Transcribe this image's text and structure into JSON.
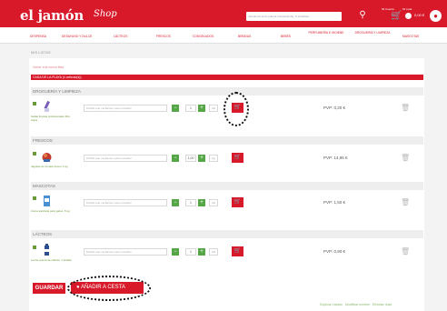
{
  "header": {
    "brand": "el jamón",
    "brand_script": "Shop",
    "search_placeholder": "Introduzca texto para la búsqueda (Ej.: 5 estrellas)",
    "utility_1": "Mi Cuenta",
    "utility_2": "Mi Lista",
    "cart_total": "0,00 €"
  },
  "nav": {
    "items": [
      "DESPENSA",
      "DESAYUNO Y DULCE",
      "LÁCTEOS",
      "FRESCOS",
      "CONGELADOS",
      "BEBIDAS",
      "BEBÉS",
      "PERFUMERÍA E HIGIENE",
      "DROGUERÍA Y LIMPIEZA",
      "MASCOTAS"
    ]
  },
  "breadcrumb": "MIS LISTAS",
  "back_link": "Volver a la nueva lista",
  "list": {
    "title": "CASA DE LA PLAYA (4 artículo(s))"
  },
  "categories": [
    {
      "name": "DROGUERÍA Y LIMPIEZA",
      "product": {
        "name": "Gafas limpias profesionales 30u. Aqua",
        "comment_placeholder": "Pedido que me llamen para consultar",
        "qty": "1",
        "unit": "Ud",
        "price": "PVP: 0,20 €"
      }
    },
    {
      "name": "FRESCOS",
      "product": {
        "name": "Jagüete de tomate fresco 1 kg",
        "comment_placeholder": "Pedido que me llamen para consultar",
        "qty": "1,00",
        "unit": "kg",
        "price": "PVP: 14,95 €"
      }
    },
    {
      "name": "MASCOTAS",
      "product": {
        "name": "Arena sanitaria para gatos, 5 kg",
        "comment_placeholder": "Pedido que me llamen para consultar",
        "qty": "1",
        "unit": "Ud",
        "price": "PVP: 1,50 €"
      }
    },
    {
      "name": "LÁCTEOS",
      "product": {
        "name": "Leche entera de cabras, 1 botella",
        "comment_placeholder": "Pedido que me llamen para consultar",
        "qty": "1",
        "unit": "Ud",
        "price": "PVP: 0,90 €"
      }
    }
  ],
  "actions": {
    "save": "GUARDAR",
    "add_to_cart": "AÑADIR A CESTA"
  },
  "footer_links": {
    "duplicate": "Duplicar Listado",
    "rename": "Modificar nombre",
    "delete": "Eliminar Lista"
  },
  "icons": {
    "search": "search-icon",
    "cart": "cart-icon",
    "user": "user-icon",
    "trash": "trash-icon",
    "add_to_cart": "cart-add-icon"
  },
  "colors": {
    "brand": "#d7192a",
    "accent_green": "#54a646",
    "link_green": "#8ab86e"
  }
}
